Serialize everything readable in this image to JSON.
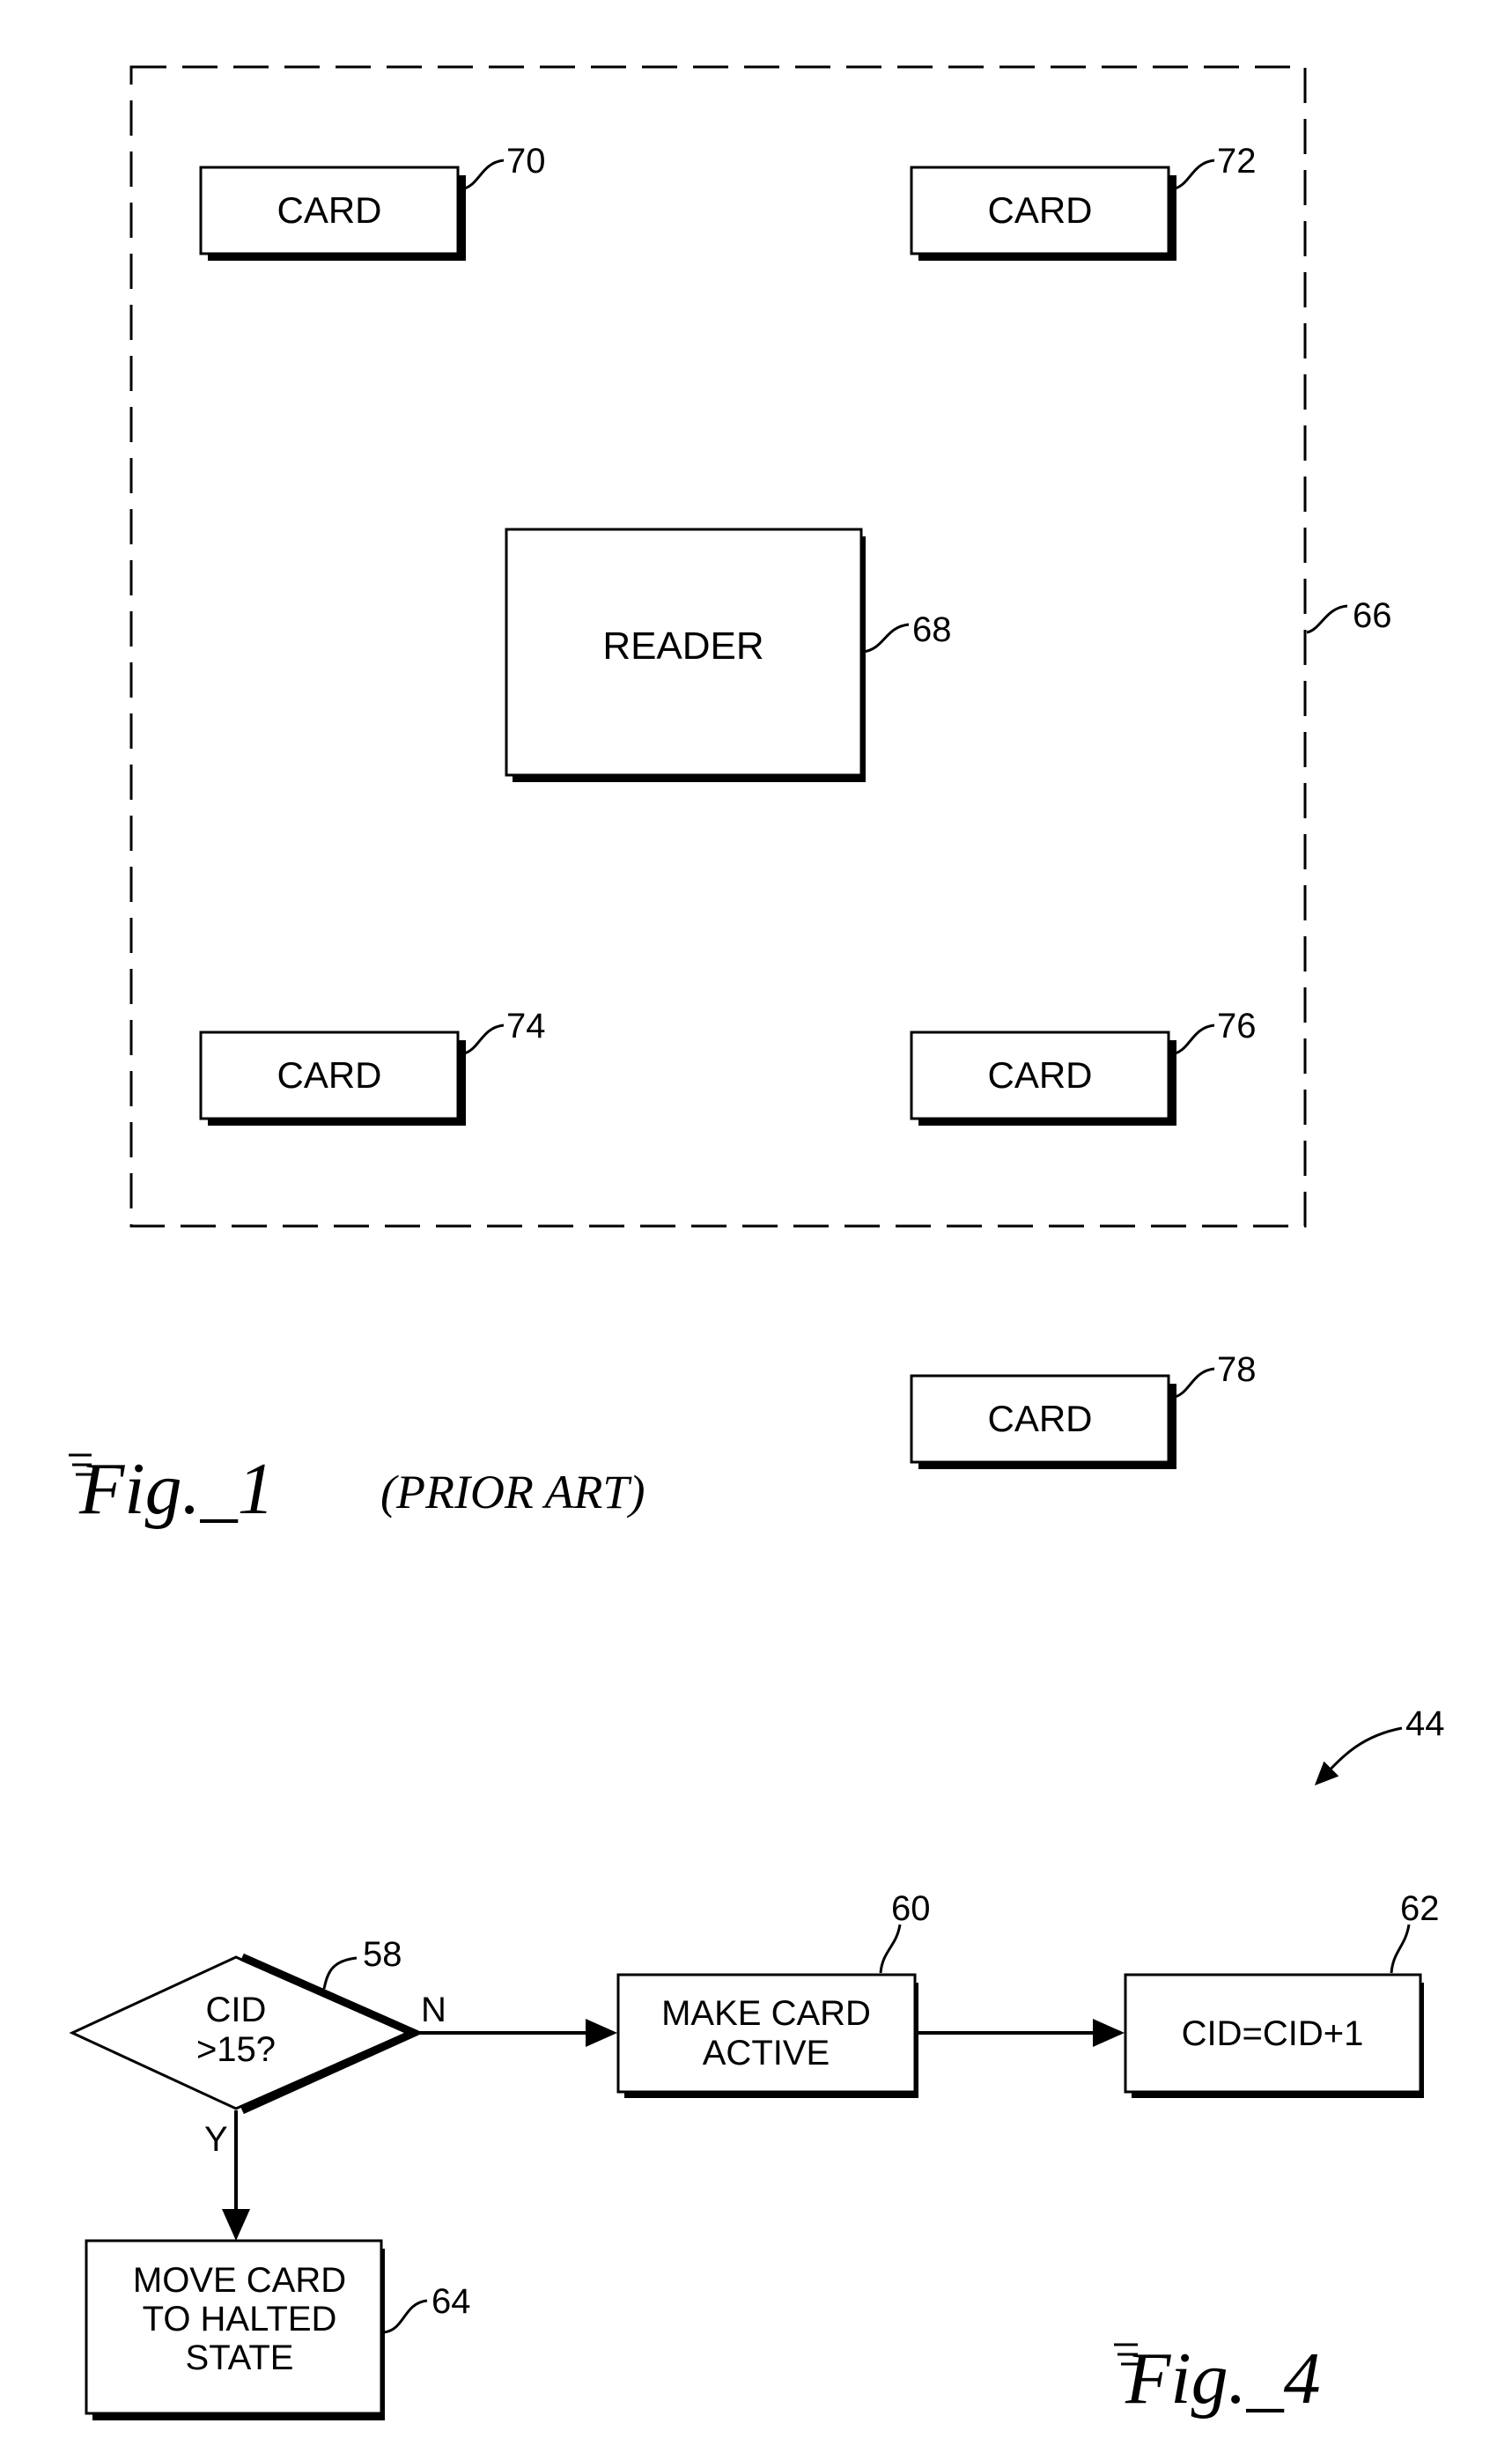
{
  "figure1": {
    "caption_main": "Fig._1",
    "caption_sub": "(PRIOR ART)",
    "field": {
      "ref": "66"
    },
    "reader": {
      "label": "READER",
      "ref": "68"
    },
    "cards": [
      {
        "label": "CARD",
        "ref": "70"
      },
      {
        "label": "CARD",
        "ref": "72"
      },
      {
        "label": "CARD",
        "ref": "74"
      },
      {
        "label": "CARD",
        "ref": "76"
      },
      {
        "label": "CARD",
        "ref": "78"
      }
    ]
  },
  "figure4": {
    "caption": "Fig._4",
    "ref": "44",
    "decision": {
      "line1": "CID",
      "line2": ">15?",
      "ref": "58",
      "no_label": "N",
      "yes_label": "Y"
    },
    "make_active": {
      "line1": "MAKE CARD",
      "line2": "ACTIVE",
      "ref": "60"
    },
    "increment": {
      "label": "CID=CID+1",
      "ref": "62"
    },
    "halt": {
      "line1": "MOVE CARD",
      "line2": "TO HALTED",
      "line3": "STATE",
      "ref": "64"
    }
  }
}
